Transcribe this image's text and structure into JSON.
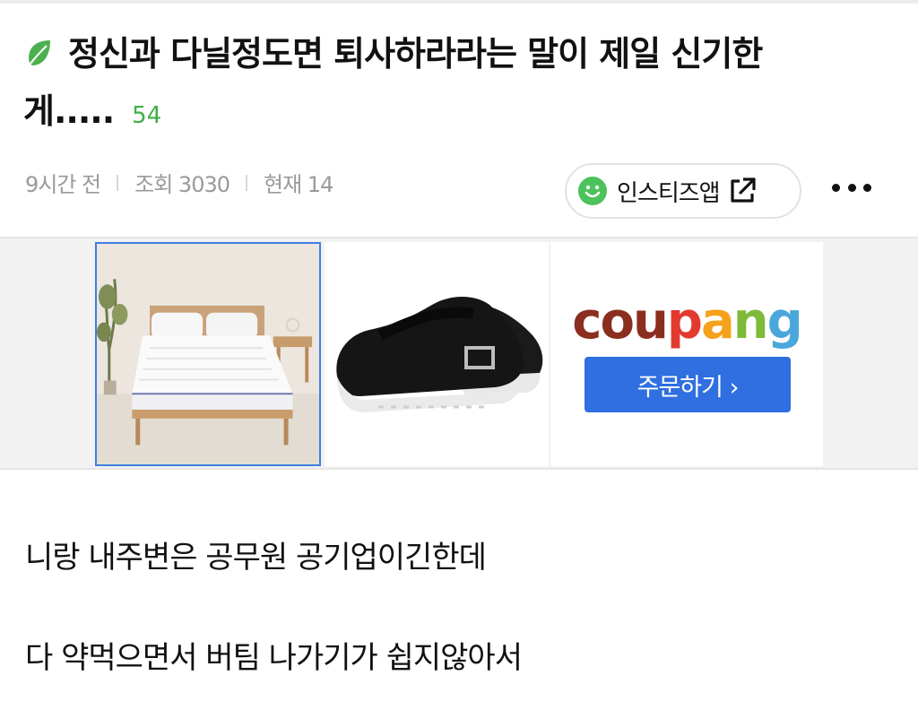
{
  "post": {
    "title": "정신과 다닐정도면 퇴사하라라는 말이 제일 신기한 게.....",
    "comment_count": "54",
    "meta": {
      "time": "9시간 전",
      "views": "조회 3030",
      "now": "현재 14"
    },
    "app_button_label": "인스티즈앱",
    "body_lines": [
      "니랑 내주변은 공무원 공기업이긴한데",
      "다 약먹으면서 버팀 나가기가 쉽지않아서"
    ]
  },
  "ad": {
    "brand_letters": [
      "c",
      "o",
      "u",
      "p",
      "a",
      "n",
      "g"
    ],
    "brand_colors": [
      "#8b2e1f",
      "#8b2e1f",
      "#8b2e1f",
      "#e23a2f",
      "#f6a11b",
      "#7fb93a",
      "#4aa7db"
    ],
    "order_label": "주문하기 ›"
  },
  "colors": {
    "accent_green": "#3fae4a",
    "order_blue": "#2f6fe0",
    "selected_border": "#3f7fe0"
  },
  "icons": [
    "leaf-icon",
    "smile-icon",
    "external-link-icon",
    "more-icon"
  ]
}
